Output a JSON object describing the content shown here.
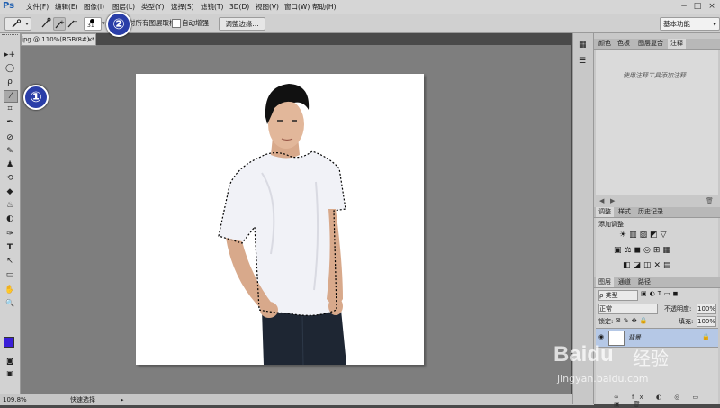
{
  "app": {
    "logo": "Ps"
  },
  "menu": [
    "文件(F)",
    "编辑(E)",
    "图像(I)",
    "图层(L)",
    "类型(Y)",
    "选择(S)",
    "滤镜(T)",
    "3D(D)",
    "视图(V)",
    "窗口(W)",
    "帮助(H)"
  ],
  "window_controls": [
    "−",
    "□",
    "×"
  ],
  "options_bar": {
    "brush_size": "31",
    "sample_all_layers": "对所有图层取样",
    "auto_enhance": "自动增强",
    "refine_edge": "调整边缘...",
    "workspace": "基本功能"
  },
  "document": {
    "tab_title": "jpg @ 110%(RGB/8#) *",
    "tab_close": "×"
  },
  "tools": [
    "▸+",
    "◯",
    "ρ",
    "⁄",
    "⌗",
    "✒",
    "⊘",
    "✎",
    "♟",
    "⟲",
    "◆",
    "♨",
    "◐",
    "✑",
    "T",
    "↖",
    "▭",
    "✋",
    "🔍"
  ],
  "colors": {
    "foreground": "#3a1fd8",
    "background": "#ffffff",
    "callout": "#2a3ea8"
  },
  "callouts": [
    "①",
    "②"
  ],
  "status": {
    "zoom": "109.8%",
    "info": "快速选择"
  },
  "panels": {
    "top_tabs": [
      "颜色",
      "色板",
      "图层复合",
      "注释"
    ],
    "notes_hint": "使用注释工具添加注释",
    "adjust_tabs": [
      "调整",
      "样式",
      "历史记录"
    ],
    "adjust_title": "添加调整",
    "layers_tabs": [
      "图层",
      "通道",
      "路径"
    ],
    "layer_filter": "ρ 类型",
    "blend_mode": "正常",
    "opacity_label": "不透明度:",
    "opacity_value": "100%",
    "lock_label": "锁定:",
    "fill_label": "填充:",
    "fill_value": "100%",
    "layer_name": "背景"
  },
  "watermark": {
    "brand": "Baidu",
    "text": "经验",
    "url": "jingyan.baidu.com"
  }
}
